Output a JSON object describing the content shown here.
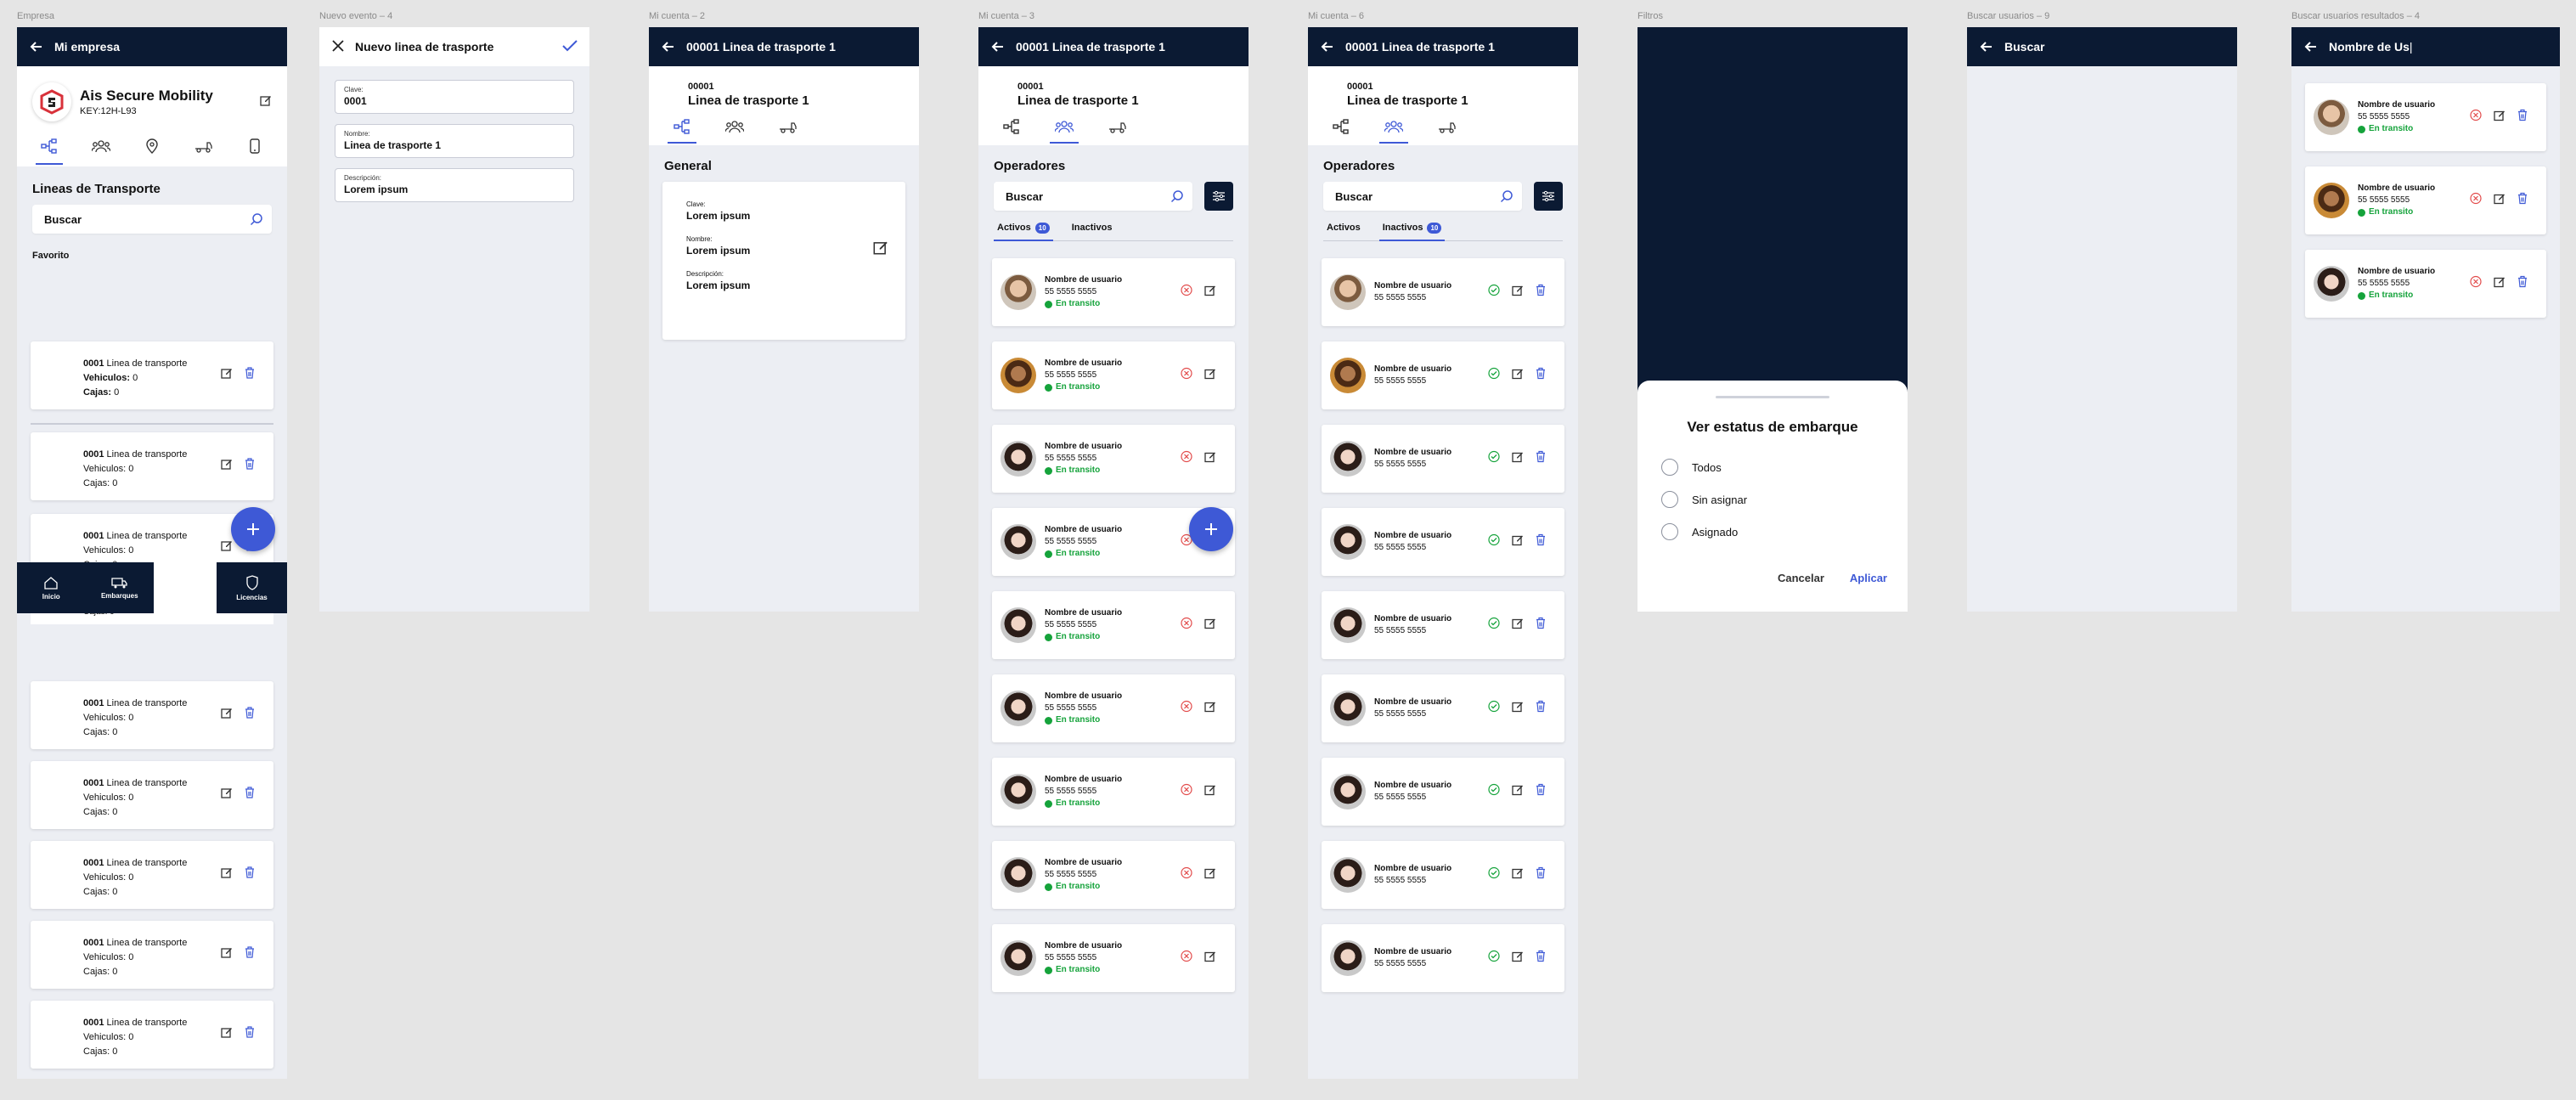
{
  "labels": {
    "empresa": "Empresa",
    "nuevo_evento": "Nuevo evento – 4",
    "mi_cuenta_2": "Mi cuenta – 2",
    "mi_cuenta_3": "Mi cuenta – 3",
    "mi_cuenta_6": "Mi cuenta – 6",
    "filtros": "Filtros",
    "buscar_usuarios": "Buscar usuarios – 9",
    "buscar_resultados": "Buscar usuarios resultados – 4"
  },
  "empresa": {
    "title": "Mi empresa",
    "company_name": "Ais Secure Mobility",
    "company_key": "KEY:12H-L93",
    "section_title": "Lineas de Transporte",
    "search_placeholder": "Buscar",
    "favorites_label": "Favorito",
    "card_code": "0001",
    "card_name": "Linea de transporte",
    "vehicles_label": "Vehiculos:",
    "vehicles_value": "0",
    "boxes_label": "Cajas:",
    "boxes_value": "0",
    "partial_boxes": "Cajas: 0",
    "nav": [
      "Inicio",
      "Embarques",
      "Licencias"
    ]
  },
  "nuevo": {
    "title": "Nuevo linea de trasporte",
    "fields": [
      {
        "label": "Clave:",
        "value": "0001"
      },
      {
        "label": "Nombre:",
        "value": "Linea de trasporte 1"
      },
      {
        "label": "Descripción:",
        "value": "Lorem ipsum"
      }
    ]
  },
  "detalle": {
    "title": "00001 Linea de trasporte 1",
    "code": "00001",
    "name": "Linea de trasporte 1",
    "general_title": "General",
    "fields": [
      {
        "label": "Clave:",
        "value": "Lorem ipsum"
      },
      {
        "label": "Nombre:",
        "value": "Lorem ipsum"
      },
      {
        "label": "Descripción:",
        "value": "Lorem ipsum"
      }
    ]
  },
  "operadores": {
    "title": "Operadores",
    "search_placeholder": "Buscar",
    "tab_active": "Activos",
    "tab_inactive": "Inactivos",
    "badge_count": "10",
    "user_name": "Nombre de usuario",
    "user_phone": "55 5555 5555",
    "status_text": "En transito"
  },
  "filtros": {
    "sheet_title": "Ver estatus de embarque",
    "options": [
      "Todos",
      "Sin asignar",
      "Asignado"
    ],
    "cancel": "Cancelar",
    "apply": "Aplicar"
  },
  "buscar": {
    "title": "Buscar"
  },
  "resultados": {
    "query": "Nombre de Us"
  },
  "colors": {
    "navy": "#0b1a33",
    "accent": "#3e59d6",
    "success": "#15a33b",
    "danger": "#e24b4b"
  }
}
